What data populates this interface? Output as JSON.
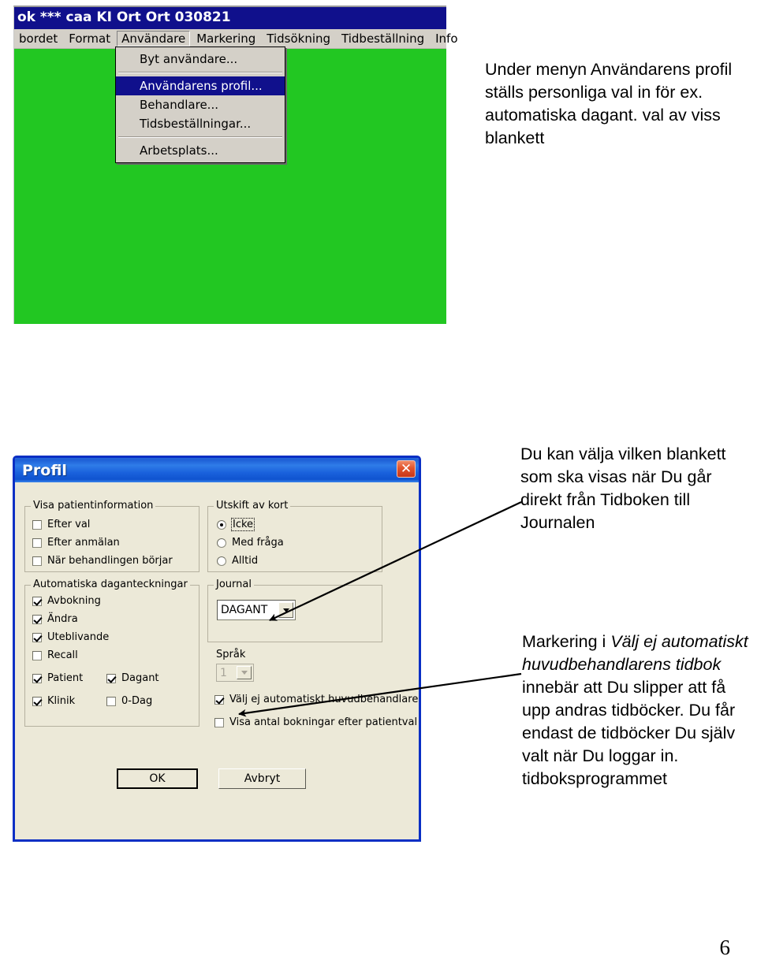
{
  "app_window": {
    "title": "ok *** caa KI Ort Ort 030821",
    "menubar": [
      {
        "label": "bordet"
      },
      {
        "label": "Format"
      },
      {
        "label": "Användare"
      },
      {
        "label": "Markering"
      },
      {
        "label": "Tidsökning"
      },
      {
        "label": "Tidbeställning"
      },
      {
        "label": "Info"
      }
    ],
    "open_menu": {
      "items": [
        {
          "label": "Byt användare...",
          "selected": false
        },
        {
          "label": "Användarens profil...",
          "selected": true
        },
        {
          "label": "Behandlare...",
          "selected": false
        },
        {
          "label": "Tidsbeställningar...",
          "selected": false
        },
        {
          "label": "Arbetsplats...",
          "selected": false
        }
      ]
    },
    "canvas_color": "#22c722",
    "titlebar_color": "#10108c"
  },
  "profil_dialog": {
    "title": "Profil",
    "close_label": "✕",
    "groups": {
      "patientinfo": {
        "title": "Visa patientinformation",
        "checkboxes": [
          {
            "label": "Efter val",
            "checked": false
          },
          {
            "label": "Efter anmälan",
            "checked": false
          },
          {
            "label": "När behandlingen börjar",
            "checked": false
          }
        ]
      },
      "utskift": {
        "title": "Utskift av kort",
        "radios": [
          {
            "label": "Icke",
            "selected": true
          },
          {
            "label": "Med fråga",
            "selected": false
          },
          {
            "label": "Alltid",
            "selected": false
          }
        ]
      },
      "daganteckningar": {
        "title": "Automatiska daganteckningar",
        "checkboxes": [
          {
            "label": "Avbokning",
            "checked": true
          },
          {
            "label": "Ändra",
            "checked": true
          },
          {
            "label": "Uteblivande",
            "checked": true
          },
          {
            "label": "Recall",
            "checked": false
          },
          {
            "label": "Patient",
            "checked": true
          },
          {
            "label": "Dagant",
            "checked": true
          },
          {
            "label": "Klinik",
            "checked": true
          },
          {
            "label": "0-Dag",
            "checked": false
          }
        ]
      },
      "journal": {
        "title": "Journal",
        "combo_value": "DAGANT"
      }
    },
    "sprak": {
      "label": "Språk",
      "combo_value": "1",
      "disabled": true
    },
    "extra_checkboxes": [
      {
        "label": "Välj ej automatiskt huvudbehandlarens tidbok",
        "checked": true
      },
      {
        "label": "Visa antal bokningar efter patientval",
        "checked": false
      }
    ],
    "buttons": {
      "ok": "OK",
      "cancel": "Avbryt"
    }
  },
  "callouts": {
    "top": "Under menyn Användarens profil ställs personliga val in för ex. automatiska dagant. val av viss blankett",
    "middle": " Du kan välja vilken blankett som ska visas när Du går direkt från Tidboken till Journalen",
    "bottom_prefix": "Markering i ",
    "bottom_italic": "Välj ej automatiskt huvudbehandlarens tidbok",
    "bottom_suffix": " innebär att Du slipper att få upp andras tidböcker. Du får endast de tidböcker  Du själv valt när Du loggar in. tidboksprogrammet"
  },
  "page": {
    "number": "6"
  }
}
